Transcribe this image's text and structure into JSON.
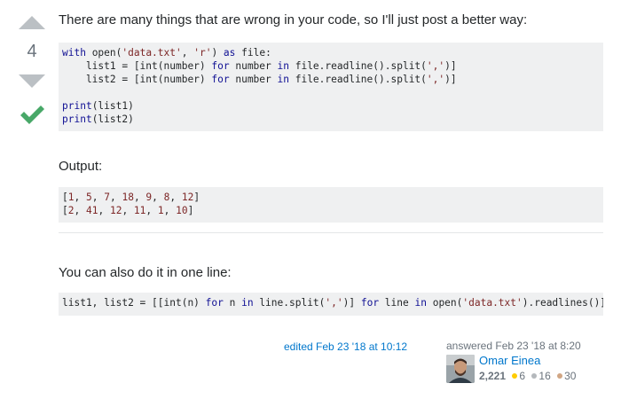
{
  "vote": {
    "score": "4",
    "accepted": true
  },
  "post": {
    "intro": "There are many things that are wrong in your code, so I'll just post a better way:",
    "code_main": {
      "lines": [
        [
          {
            "t": "with",
            "c": "kw"
          },
          {
            "t": " open(",
            "c": ""
          },
          {
            "t": "'data.txt'",
            "c": "str"
          },
          {
            "t": ", ",
            "c": ""
          },
          {
            "t": "'r'",
            "c": "str"
          },
          {
            "t": ") ",
            "c": ""
          },
          {
            "t": "as",
            "c": "kw"
          },
          {
            "t": " file:",
            "c": ""
          }
        ],
        [
          {
            "t": "    list1 = [int(number) ",
            "c": ""
          },
          {
            "t": "for",
            "c": "kw"
          },
          {
            "t": " number ",
            "c": ""
          },
          {
            "t": "in",
            "c": "kw"
          },
          {
            "t": " file.readline().split(",
            "c": ""
          },
          {
            "t": "','",
            "c": "str"
          },
          {
            "t": ")]",
            "c": ""
          }
        ],
        [
          {
            "t": "    list2 = [int(number) ",
            "c": ""
          },
          {
            "t": "for",
            "c": "kw"
          },
          {
            "t": " number ",
            "c": ""
          },
          {
            "t": "in",
            "c": "kw"
          },
          {
            "t": " file.readline().split(",
            "c": ""
          },
          {
            "t": "','",
            "c": "str"
          },
          {
            "t": ")]",
            "c": ""
          }
        ],
        [
          {
            "t": "",
            "c": ""
          }
        ],
        [
          {
            "t": "print",
            "c": "kw"
          },
          {
            "t": "(list1)",
            "c": ""
          }
        ],
        [
          {
            "t": "print",
            "c": "kw"
          },
          {
            "t": "(list2)",
            "c": ""
          }
        ]
      ]
    },
    "output_label": "Output:",
    "code_output": {
      "lines": [
        [
          {
            "t": "[",
            "c": ""
          },
          {
            "t": "1",
            "c": "num"
          },
          {
            "t": ", ",
            "c": ""
          },
          {
            "t": "5",
            "c": "num"
          },
          {
            "t": ", ",
            "c": ""
          },
          {
            "t": "7",
            "c": "num"
          },
          {
            "t": ", ",
            "c": ""
          },
          {
            "t": "18",
            "c": "num"
          },
          {
            "t": ", ",
            "c": ""
          },
          {
            "t": "9",
            "c": "num"
          },
          {
            "t": ", ",
            "c": ""
          },
          {
            "t": "8",
            "c": "num"
          },
          {
            "t": ", ",
            "c": ""
          },
          {
            "t": "12",
            "c": "num"
          },
          {
            "t": "]",
            "c": ""
          }
        ],
        [
          {
            "t": "[",
            "c": ""
          },
          {
            "t": "2",
            "c": "num"
          },
          {
            "t": ", ",
            "c": ""
          },
          {
            "t": "41",
            "c": "num"
          },
          {
            "t": ", ",
            "c": ""
          },
          {
            "t": "12",
            "c": "num"
          },
          {
            "t": ", ",
            "c": ""
          },
          {
            "t": "11",
            "c": "num"
          },
          {
            "t": ", ",
            "c": ""
          },
          {
            "t": "1",
            "c": "num"
          },
          {
            "t": ", ",
            "c": ""
          },
          {
            "t": "10",
            "c": "num"
          },
          {
            "t": "]",
            "c": ""
          }
        ]
      ]
    },
    "oneline_label": "You can also do it in one line:",
    "code_oneline": {
      "lines": [
        [
          {
            "t": "list1, list2 = [[int(n) ",
            "c": ""
          },
          {
            "t": "for",
            "c": "kw"
          },
          {
            "t": " n ",
            "c": ""
          },
          {
            "t": "in",
            "c": "kw"
          },
          {
            "t": " line.split(",
            "c": ""
          },
          {
            "t": "','",
            "c": "str"
          },
          {
            "t": ")] ",
            "c": ""
          },
          {
            "t": "for",
            "c": "kw"
          },
          {
            "t": " line ",
            "c": ""
          },
          {
            "t": "in",
            "c": "kw"
          },
          {
            "t": " open(",
            "c": ""
          },
          {
            "t": "'data.txt'",
            "c": "str"
          },
          {
            "t": ").readlines()]",
            "c": ""
          }
        ]
      ]
    }
  },
  "signature": {
    "edited": "edited Feb 23 '18 at 10:12",
    "answered": "answered Feb 23 '18 at 8:20",
    "user_name": "Omar Einea",
    "reputation": "2,221",
    "badges": {
      "gold": "6",
      "silver": "16",
      "bronze": "30"
    }
  },
  "colors": {
    "vote_arrow": "#bbc0c4",
    "accepted": "#48a868",
    "link": "#0077cc",
    "code_bg": "#eff0f1",
    "gold": "#ffcc01",
    "silver": "#b4b8bc",
    "bronze": "#d1a684"
  },
  "icons": {
    "upvote": "triangle-up",
    "downvote": "triangle-down",
    "accepted": "checkmark"
  }
}
